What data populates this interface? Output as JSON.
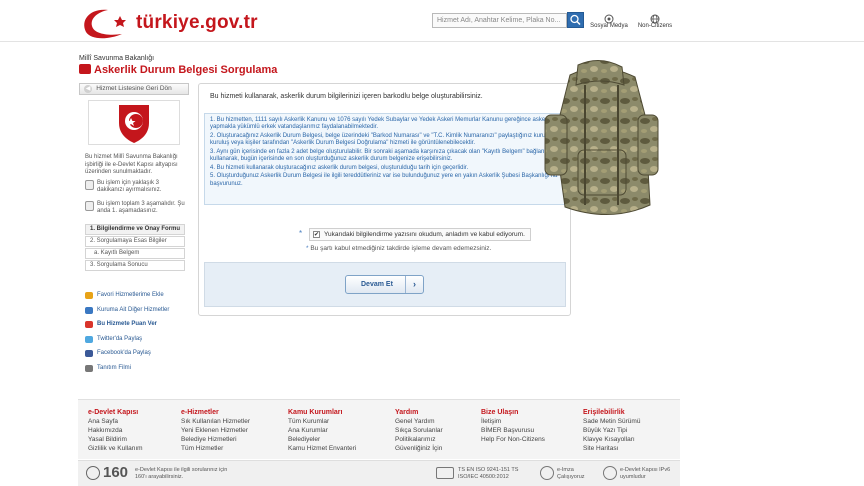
{
  "header": {
    "brand": "türkiye.gov.tr",
    "search_placeholder": "Hizmet Adı, Anahtar Kelime, Plaka No...",
    "social_label": "Sosyal Medya",
    "noncitizens_label": "Non-Citizens"
  },
  "breadcrumb": {
    "kicker": "Millî Savunma Bakanlığı",
    "title": "Askerlik Durum Belgesi Sorgulama"
  },
  "sidebar": {
    "back_label": "Hizmet Listesine Geri Dön",
    "description": "Bu hizmet Millî Savunma Bakanlığı işbirliği ile e-Devlet Kapısı altyapısı üzerinden sunulmaktadır.",
    "info_time": "Bu işlem için yaklaşık 3 dakikanızı ayırmalısınız.",
    "info_steps": "Bu işlem toplam 3 aşamalıdır. Şu anda 1. aşamadasınız.",
    "steps": [
      {
        "label": "1. Bilgilendirme ve Onay Formu"
      },
      {
        "label": "2. Sorgulamaya Esas Bilgiler"
      },
      {
        "label": "a. Kayıtlı Belgem"
      },
      {
        "label": "3. Sorgulama Sonucu"
      }
    ],
    "links": [
      {
        "label": "Favori Hizmetlerime Ekle",
        "color": "#e8a317"
      },
      {
        "label": "Kuruma Ait Diğer Hizmetler",
        "color": "#3a78c2"
      },
      {
        "label": "Bu Hizmete Puan Ver",
        "color": "#d9342b"
      },
      {
        "label": "Twitter'da Paylaş",
        "color": "#4fa8e0"
      },
      {
        "label": "Facebook'da Paylaş",
        "color": "#3b5998"
      },
      {
        "label": "Tanıtım Filmi",
        "color": "#777777"
      }
    ]
  },
  "main": {
    "intro": "Bu hizmeti kullanarak, askerlik durum bilgilerinizi içeren barkodlu belge oluşturabilirsiniz.",
    "notes": [
      "1. Bu hizmetten, 1111 sayılı Askerlik Kanunu ve 1076 sayılı Yedek Subaylar ve Yedek Askeri Memurlar Kanunu gereğince askerlik yapmakla yükümlü erkek vatandaşlarımız faydalanabilmektedir.",
      "2. Oluşturacağınız Askerlik Durum Belgesi, belge üzerindeki \"Barkod Numarası\" ve \"T.C. Kimlik Numaranızı\" paylaştığınız kurum, kuruluş veya kişiler tarafından \"Askerlik Durum Belgesi Doğrulama\" hizmeti ile görüntülenebilecektir.",
      "3. Aynı gün içerisinde en fazla 2 adet belge oluşturulabilir. Bir sonraki aşamada karşınıza çıkacak olan \"Kayıtlı Belgem\" bağlantısını kullanarak, bugün içerisinde en son oluşturduğunuz askerlik durum belgenize erişebilirsiniz.",
      "4. Bu hizmeti kullanarak oluşturacağınız askerlik durum belgesi, oluşturulduğu tarih için geçerlidir.",
      "5. Oluşturduğunuz Askerlik Durum Belgesi ile ilgili tereddütleriniz var ise bulunduğunuz yere en yakın Askerlik Şubesi Başkanlığı'na başvurunuz."
    ],
    "agree_label": "Yukarıdaki bilgilendirme yazısını okudum, anladım ve kabul ediyorum.",
    "warning": "Bu şartı kabul etmediğiniz takdirde işleme devam edemezsiniz.",
    "continue_label": "Devam Et"
  },
  "footer": {
    "columns": [
      {
        "heading": "e-Devlet Kapısı",
        "items": [
          "Ana Sayfa",
          "Hakkımızda",
          "Yasal Bildirim",
          "Gizlilik ve Kullanım"
        ]
      },
      {
        "heading": "e-Hizmetler",
        "items": [
          "Sık Kullanılan Hizmetler",
          "Yeni Eklenen Hizmetler",
          "Belediye Hizmetleri",
          "Tüm Hizmetler"
        ]
      },
      {
        "heading": "Kamu Kurumları",
        "items": [
          "Tüm Kurumlar",
          "Ana Kurumlar",
          "Belediyeler",
          "Kamu Hizmet Envanteri"
        ]
      },
      {
        "heading": "Yardım",
        "items": [
          "Genel Yardım",
          "Sıkça Sorulanlar",
          "Politikalarımız",
          "Güvenliğiniz İçin"
        ]
      },
      {
        "heading": "Bize Ulaşın",
        "items": [
          "İletişim",
          "BİMER Başvurusu",
          "Help For Non-Citizens"
        ]
      },
      {
        "heading": "Erişilebilirlik",
        "items": [
          "Sade Metin Sürümü",
          "Büyük Yazı Tipi",
          "Klavye Kısayolları",
          "Site Haritası"
        ]
      }
    ],
    "callcenter_number": "160",
    "callcenter_text": "e-Devlet Kapısı ile ilgili sorularınız için 160'ı arayabilirsiniz.",
    "iso_text": "TS EN ISO 9241-151 TS ISO/IEC 40500:2012",
    "integrated_text": "e-Imza Çalışıyoruz",
    "ipv6_text": "e-Devlet Kapısı IPv6 uyumludur"
  }
}
